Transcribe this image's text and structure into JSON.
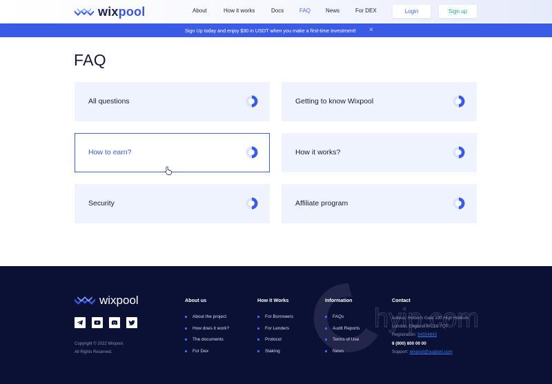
{
  "header": {
    "logo_prefix": "wix",
    "logo_suffix": "pool",
    "nav": [
      "About",
      "How it works",
      "Docs",
      "FAQ",
      "News",
      "For DEX"
    ],
    "active_nav": "FAQ",
    "login_label": "Login",
    "signup_label": "Sign up"
  },
  "banner": {
    "text": "Sign Up today and enjoy $30 in USDT when you make a first-time investment!",
    "close": "×"
  },
  "main": {
    "title": "FAQ",
    "categories": [
      {
        "label": "All questions"
      },
      {
        "label": "Getting to know Wixpool"
      },
      {
        "label": "How to earn?"
      },
      {
        "label": "How it works?"
      },
      {
        "label": "Security"
      },
      {
        "label": "Affiliate program"
      }
    ],
    "active_category": "How to earn?"
  },
  "footer": {
    "logo_text": "wixpool",
    "socials": [
      "telegram-icon",
      "youtube-icon",
      "discord-icon",
      "twitter-icon"
    ],
    "copyright_line1": "Copyright © 2022 Wixpool.",
    "copyright_line2": "All Rights Reserved.",
    "columns": [
      {
        "title": "About us",
        "items": [
          "About the project",
          "How does it work?",
          "The documents",
          "For Dex"
        ]
      },
      {
        "title": "How it Works",
        "items": [
          "For Borrowers",
          "For Lenders",
          "Protocol",
          "Staking"
        ]
      },
      {
        "title": "Information",
        "items": [
          "FAQs",
          "Audit Reports",
          "Terms of Use",
          "News"
        ]
      }
    ],
    "contact": {
      "title": "Contact",
      "address_line1": "Adress: Holborn Gate 330 High Holborn",
      "address_line2": "London, England WC1V 7QT",
      "registration_label": "Registration:",
      "registration_number": "54354643",
      "phone": "8 (800) 800 00 00",
      "support_label": "Support:",
      "support_email": "wixpool@support.com"
    },
    "watermark_text": "hyip.com"
  },
  "colors": {
    "accent": "#3a5be6",
    "signup": "#17b07a",
    "footer_bg": "#0b1035",
    "card_bg": "#eff3fd"
  }
}
